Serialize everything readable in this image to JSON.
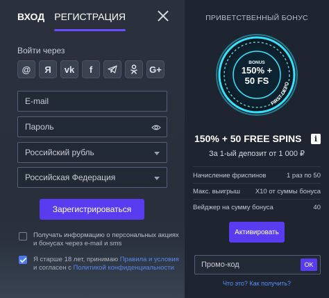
{
  "tabs": {
    "login": "ВХОД",
    "register": "РЕГИСТРАЦИЯ"
  },
  "login_via": "Войти через",
  "socials": [
    {
      "icon": "at-icon",
      "glyph": "@"
    },
    {
      "icon": "yandex-icon",
      "glyph": "Я"
    },
    {
      "icon": "vk-icon",
      "glyph": "vk"
    },
    {
      "icon": "facebook-icon",
      "glyph": "f"
    },
    {
      "icon": "telegram-icon",
      "glyph": ""
    },
    {
      "icon": "odnoklassniki-icon",
      "glyph": ""
    },
    {
      "icon": "google-plus-icon",
      "glyph": "G+"
    }
  ],
  "form": {
    "email_placeholder": "E-mail",
    "password_placeholder": "Пароль",
    "currency": "Российский рубль",
    "country": "Российская Федерация",
    "submit": "Зарегистрироваться"
  },
  "checkboxes": {
    "newsletter": "Получать информацию о персональных акциях и бонусах через e-mail и sms",
    "terms_pre": "Я старше 18 лет, принимаю ",
    "terms_link1": "Правила и условия",
    "terms_mid": " и согласен с ",
    "terms_link2": "Политикой конфиденциальности"
  },
  "bonus": {
    "title": "ПРИВЕТСТВЕННЫЙ БОНУС",
    "wheel_label": "BONUS",
    "wheel_pct": "150% +",
    "wheel_fs": "50 FS",
    "wheel_ring": "FIRST DEPOSIT",
    "headline": "150% + 50 FREE SPINS",
    "info": "i",
    "deposit": "За 1-ый депозит от 1 000 ₽",
    "rows": [
      {
        "label": "Начисление фриспинов",
        "value": "1 раз по 50"
      },
      {
        "label": "Макс. выигрыш",
        "value": "X10 от суммы бонуса"
      },
      {
        "label": "Вейджер на сумму бонуса",
        "value": "40"
      }
    ],
    "activate": "Активировать",
    "promo_placeholder": "Промо-код",
    "ok": "OK",
    "what": "Что это? Как получить?"
  },
  "colors": {
    "accent": "#5a3cf0",
    "link": "#5c8dff",
    "tab_underline": "#6a4dff"
  }
}
